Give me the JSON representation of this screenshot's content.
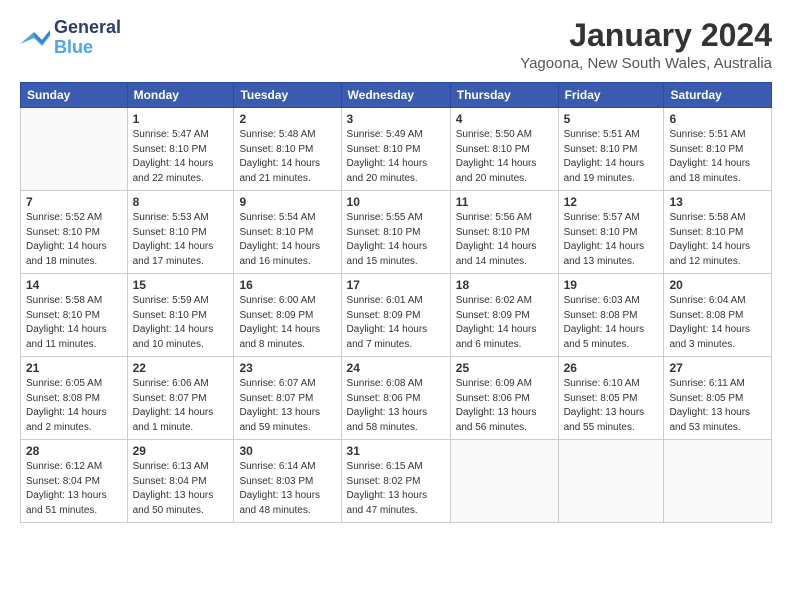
{
  "header": {
    "logo_line1": "General",
    "logo_line2": "Blue",
    "month": "January 2024",
    "location": "Yagoona, New South Wales, Australia"
  },
  "weekdays": [
    "Sunday",
    "Monday",
    "Tuesday",
    "Wednesday",
    "Thursday",
    "Friday",
    "Saturday"
  ],
  "weeks": [
    [
      {
        "day": "",
        "info": ""
      },
      {
        "day": "1",
        "info": "Sunrise: 5:47 AM\nSunset: 8:10 PM\nDaylight: 14 hours\nand 22 minutes."
      },
      {
        "day": "2",
        "info": "Sunrise: 5:48 AM\nSunset: 8:10 PM\nDaylight: 14 hours\nand 21 minutes."
      },
      {
        "day": "3",
        "info": "Sunrise: 5:49 AM\nSunset: 8:10 PM\nDaylight: 14 hours\nand 20 minutes."
      },
      {
        "day": "4",
        "info": "Sunrise: 5:50 AM\nSunset: 8:10 PM\nDaylight: 14 hours\nand 20 minutes."
      },
      {
        "day": "5",
        "info": "Sunrise: 5:51 AM\nSunset: 8:10 PM\nDaylight: 14 hours\nand 19 minutes."
      },
      {
        "day": "6",
        "info": "Sunrise: 5:51 AM\nSunset: 8:10 PM\nDaylight: 14 hours\nand 18 minutes."
      }
    ],
    [
      {
        "day": "7",
        "info": "Sunrise: 5:52 AM\nSunset: 8:10 PM\nDaylight: 14 hours\nand 18 minutes."
      },
      {
        "day": "8",
        "info": "Sunrise: 5:53 AM\nSunset: 8:10 PM\nDaylight: 14 hours\nand 17 minutes."
      },
      {
        "day": "9",
        "info": "Sunrise: 5:54 AM\nSunset: 8:10 PM\nDaylight: 14 hours\nand 16 minutes."
      },
      {
        "day": "10",
        "info": "Sunrise: 5:55 AM\nSunset: 8:10 PM\nDaylight: 14 hours\nand 15 minutes."
      },
      {
        "day": "11",
        "info": "Sunrise: 5:56 AM\nSunset: 8:10 PM\nDaylight: 14 hours\nand 14 minutes."
      },
      {
        "day": "12",
        "info": "Sunrise: 5:57 AM\nSunset: 8:10 PM\nDaylight: 14 hours\nand 13 minutes."
      },
      {
        "day": "13",
        "info": "Sunrise: 5:58 AM\nSunset: 8:10 PM\nDaylight: 14 hours\nand 12 minutes."
      }
    ],
    [
      {
        "day": "14",
        "info": "Sunrise: 5:58 AM\nSunset: 8:10 PM\nDaylight: 14 hours\nand 11 minutes."
      },
      {
        "day": "15",
        "info": "Sunrise: 5:59 AM\nSunset: 8:10 PM\nDaylight: 14 hours\nand 10 minutes."
      },
      {
        "day": "16",
        "info": "Sunrise: 6:00 AM\nSunset: 8:09 PM\nDaylight: 14 hours\nand 8 minutes."
      },
      {
        "day": "17",
        "info": "Sunrise: 6:01 AM\nSunset: 8:09 PM\nDaylight: 14 hours\nand 7 minutes."
      },
      {
        "day": "18",
        "info": "Sunrise: 6:02 AM\nSunset: 8:09 PM\nDaylight: 14 hours\nand 6 minutes."
      },
      {
        "day": "19",
        "info": "Sunrise: 6:03 AM\nSunset: 8:08 PM\nDaylight: 14 hours\nand 5 minutes."
      },
      {
        "day": "20",
        "info": "Sunrise: 6:04 AM\nSunset: 8:08 PM\nDaylight: 14 hours\nand 3 minutes."
      }
    ],
    [
      {
        "day": "21",
        "info": "Sunrise: 6:05 AM\nSunset: 8:08 PM\nDaylight: 14 hours\nand 2 minutes."
      },
      {
        "day": "22",
        "info": "Sunrise: 6:06 AM\nSunset: 8:07 PM\nDaylight: 14 hours\nand 1 minute."
      },
      {
        "day": "23",
        "info": "Sunrise: 6:07 AM\nSunset: 8:07 PM\nDaylight: 13 hours\nand 59 minutes."
      },
      {
        "day": "24",
        "info": "Sunrise: 6:08 AM\nSunset: 8:06 PM\nDaylight: 13 hours\nand 58 minutes."
      },
      {
        "day": "25",
        "info": "Sunrise: 6:09 AM\nSunset: 8:06 PM\nDaylight: 13 hours\nand 56 minutes."
      },
      {
        "day": "26",
        "info": "Sunrise: 6:10 AM\nSunset: 8:05 PM\nDaylight: 13 hours\nand 55 minutes."
      },
      {
        "day": "27",
        "info": "Sunrise: 6:11 AM\nSunset: 8:05 PM\nDaylight: 13 hours\nand 53 minutes."
      }
    ],
    [
      {
        "day": "28",
        "info": "Sunrise: 6:12 AM\nSunset: 8:04 PM\nDaylight: 13 hours\nand 51 minutes."
      },
      {
        "day": "29",
        "info": "Sunrise: 6:13 AM\nSunset: 8:04 PM\nDaylight: 13 hours\nand 50 minutes."
      },
      {
        "day": "30",
        "info": "Sunrise: 6:14 AM\nSunset: 8:03 PM\nDaylight: 13 hours\nand 48 minutes."
      },
      {
        "day": "31",
        "info": "Sunrise: 6:15 AM\nSunset: 8:02 PM\nDaylight: 13 hours\nand 47 minutes."
      },
      {
        "day": "",
        "info": ""
      },
      {
        "day": "",
        "info": ""
      },
      {
        "day": "",
        "info": ""
      }
    ]
  ]
}
